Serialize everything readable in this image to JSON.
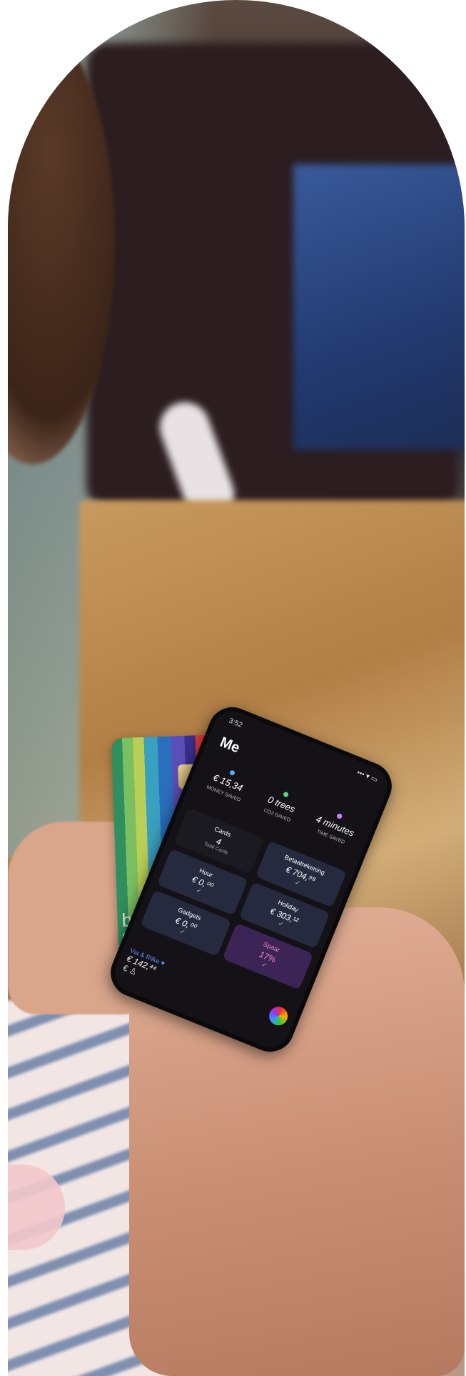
{
  "card": {
    "brand": "bunq",
    "type": "debit",
    "contactless_symbol": "))))"
  },
  "phone": {
    "status_time": "3:52",
    "status_icons": "••• ▾ ▭",
    "screen_title": "Me",
    "stats": [
      {
        "value": "€ 15,34",
        "label": "MONEY SAVED",
        "color": "#4fb0ff"
      },
      {
        "value": "0 trees",
        "label": "CO2 SAVED",
        "color": "#5fd28a"
      },
      {
        "value": "4 minutes",
        "label": "TIME SAVED",
        "color": "#d080ff"
      }
    ],
    "tiles": [
      {
        "name": "Cards",
        "amount": "4",
        "sub": "Total Cards",
        "style": "plain"
      },
      {
        "name": "Betaalrekening",
        "amount": "€ 704,⁹⁸",
        "sub": "✓",
        "style": ""
      },
      {
        "name": "Huur",
        "amount": "€ 0,⁰⁰",
        "sub": "✓",
        "style": ""
      },
      {
        "name": "Holiday",
        "amount": "€ 303,¹²",
        "sub": "✓",
        "style": ""
      },
      {
        "name": "Gadgets",
        "amount": "€ 0,⁰⁰",
        "sub": "✓",
        "style": ""
      },
      {
        "name": "Spaar",
        "amount": "17%",
        "sub": "✓",
        "style": "purple"
      }
    ],
    "joint": {
      "name": "Via & Rilke ♥",
      "amount": "€ 142,⁴⁴"
    },
    "nav_icons": [
      "euro-icon",
      "profile-icon",
      "avatar"
    ]
  }
}
